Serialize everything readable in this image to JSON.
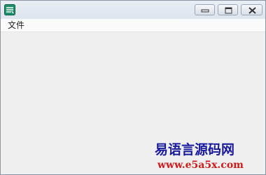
{
  "window": {
    "title": "",
    "app_icon": "app-icon"
  },
  "titlebar": {
    "buttons": {
      "minimize_icon": "minimize-icon",
      "maximize_icon": "maximize-icon",
      "close_icon": "close-icon"
    }
  },
  "menu": {
    "items": [
      {
        "label": "文件"
      }
    ]
  },
  "watermark": {
    "title": "易语言源码网",
    "url": "www.e5a5x.com",
    "title_color": "#1a1a9c",
    "url_color": "#d11a1a"
  },
  "colors": {
    "client_bg": "#f0f0f0",
    "menubar_bg": "#fbfbfb",
    "titlebar_bg": "#e4eaf1"
  }
}
